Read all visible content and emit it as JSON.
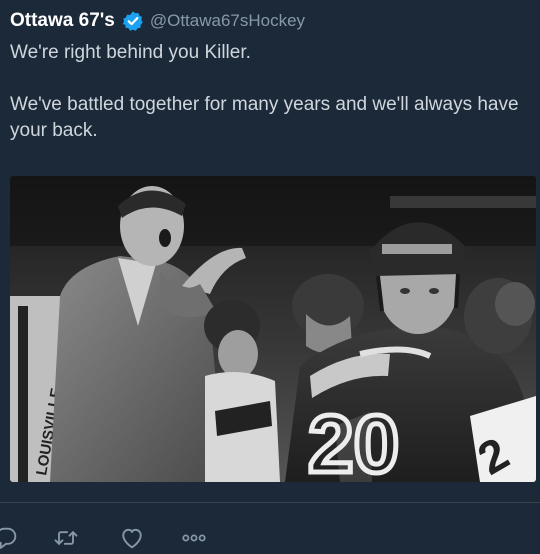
{
  "tweet": {
    "display_name": "Ottawa 67's",
    "handle": "@Ottawa67sHockey",
    "verified": true,
    "text_line1": "We're right behind you Killer.",
    "text_line2": "We've battled together for many years and we'll always have your back."
  },
  "media": {
    "jersey_number": "20",
    "jersey_number_partial": "2",
    "banner_text": "LOUISVILLE"
  },
  "actions": [
    {
      "name": "reply",
      "icon": "speech-bubble-icon"
    },
    {
      "name": "retweet",
      "icon": "retweet-arrows-icon"
    },
    {
      "name": "like",
      "icon": "heart-icon"
    },
    {
      "name": "more",
      "icon": "ellipsis-icon"
    }
  ],
  "colors": {
    "background": "#1c2938",
    "text": "#cfd6dd",
    "muted": "#8899a6",
    "verified": "#1da1f2"
  }
}
